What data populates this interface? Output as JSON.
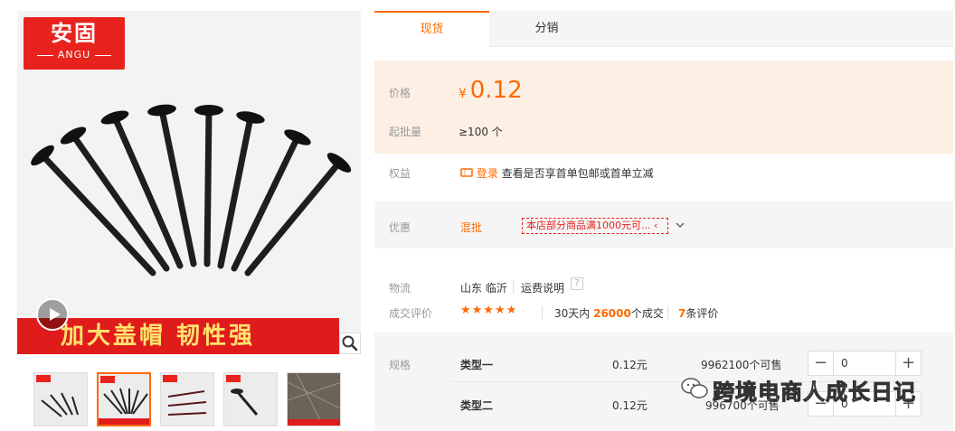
{
  "gallery": {
    "logo_cn": "安固",
    "logo_en": "ANGU",
    "banner_text": "加大盖帽  韧性强",
    "play_icon": "play-icon",
    "zoom_icon": "magnifier-icon"
  },
  "tabs": [
    {
      "label": "现货",
      "active": true
    },
    {
      "label": "分销",
      "active": false
    }
  ],
  "price": {
    "label": "价格",
    "currency": "¥",
    "value": "0.12"
  },
  "moq": {
    "label": "起批量",
    "value": "≥100 个"
  },
  "benefits": {
    "label": "权益",
    "login_link": "登录",
    "text": "查看是否享首单包邮或首单立减"
  },
  "promo": {
    "label": "优惠",
    "tag": "混批",
    "coupon": "本店部分商品满1000元可... ‹"
  },
  "logistics": {
    "label": "物流",
    "origin": "山东 临沂",
    "shipping_link": "运费说明",
    "help": "?"
  },
  "reviews": {
    "label": "成交评价",
    "stars": "★★★★★",
    "rating_fraction": 0.9,
    "days_text": "30天内",
    "deals_count": "26000",
    "deals_suffix": "个成交",
    "review_count": "7",
    "review_suffix": "条评价"
  },
  "specs": {
    "label": "规格",
    "rows": [
      {
        "name": "类型一",
        "price": "0.12元",
        "stock": "9962100个可售",
        "qty": "0"
      },
      {
        "name": "类型二",
        "price": "0.12元",
        "stock": "996700个可售",
        "qty": "0"
      }
    ],
    "minus": "−",
    "plus": "+"
  },
  "watermark": "跨境电商人成长日记",
  "colors": {
    "accent": "#ff6a00",
    "brand_red": "#e8231d",
    "price_bg": "#fdefe3",
    "star": "#ff6a00"
  }
}
